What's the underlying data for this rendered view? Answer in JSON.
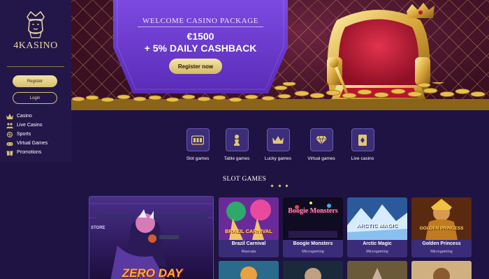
{
  "brand": {
    "logo_text": "4KASINO"
  },
  "sidebar": {
    "register_label": "Register",
    "login_label": "Login",
    "nav": [
      {
        "label": "Casino",
        "icon": "crown-icon"
      },
      {
        "label": "Live Casino",
        "icon": "people-icon"
      },
      {
        "label": "Sports",
        "icon": "ball-icon"
      },
      {
        "label": "Virtual Games",
        "icon": "gamepad-icon"
      },
      {
        "label": "Promotions",
        "icon": "gift-icon"
      }
    ]
  },
  "hero": {
    "kicker": "WELCOME CASINO PACKAGE",
    "amount": "€1500",
    "subline": "+ 5% DAILY CASHBACK",
    "cta_label": "Register now"
  },
  "categories": [
    {
      "label": "Slot games",
      "icon": "slot-machine-icon"
    },
    {
      "label": "Table games",
      "icon": "chess-pawn-icon"
    },
    {
      "label": "Lucky games",
      "icon": "crown-icon"
    },
    {
      "label": "Virtual games",
      "icon": "diamond-icon"
    },
    {
      "label": "Live casino",
      "icon": "playing-card-icon"
    }
  ],
  "slot_section": {
    "title": "SLOT GAMES"
  },
  "featured_game": {
    "art_text": "ZERO DAY",
    "art_small": "STORE"
  },
  "games": [
    {
      "title": "Brazil Carnival",
      "provider": "Mascala",
      "art_text": "BRAZIL CARNIVAL"
    },
    {
      "title": "Boogie Monsters",
      "provider": "Microgaming",
      "art_text": "Boogie Monsters"
    },
    {
      "title": "Arctic Magic",
      "provider": "Microgaming",
      "art_text": "ARCTIC MAGIC"
    },
    {
      "title": "Golden Princess",
      "provider": "Microgaming",
      "art_text": "GOLDEN PRINCESS"
    }
  ],
  "colors": {
    "background": "#1e1342",
    "sidebar": "#23174a",
    "gold": "#d8c071",
    "tile": "#3b2d78",
    "hero_purple": "#6b3fd0"
  }
}
